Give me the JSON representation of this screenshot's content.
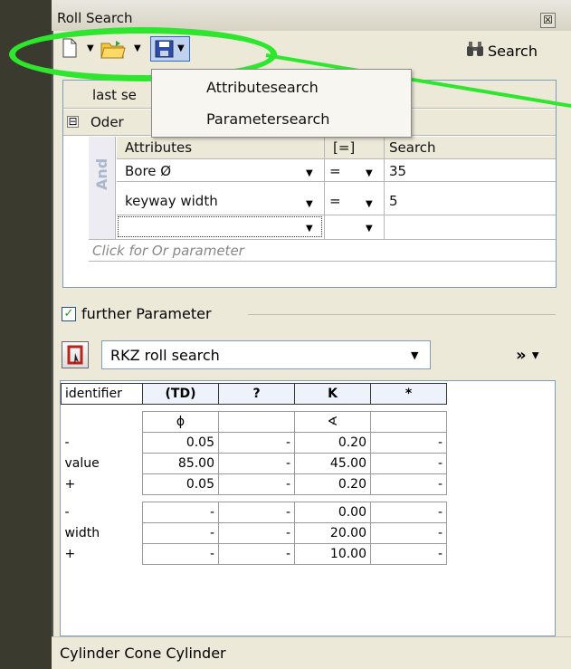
{
  "window": {
    "title": "Roll Search",
    "close_symbol": "☒"
  },
  "toolbar": {
    "search_label": "Search"
  },
  "dropdown_menu": {
    "items": [
      "Attributesearch",
      "Parametersearch"
    ]
  },
  "attribute_grid": {
    "tab_label": "last se",
    "group_label": "Oder",
    "and_label": "And",
    "headers": {
      "attributes": "Attributes",
      "operator": "[=]",
      "search": "Search"
    },
    "rows": [
      {
        "attribute": "Bore Ø",
        "operator": "=",
        "value": "35"
      },
      {
        "attribute": "keyway width",
        "operator": "=",
        "value": "5"
      },
      {
        "attribute": "",
        "operator": "",
        "value": ""
      }
    ],
    "or_placeholder": "Click for Or parameter",
    "expander_symbol": "⊟"
  },
  "further_parameter": {
    "label": "further Parameter",
    "checked": true
  },
  "roll_search": {
    "selected": "RKZ roll search",
    "more_symbol": "»"
  },
  "param_table": {
    "identifier_label": "identifier",
    "columns": [
      "(TD)",
      "?",
      "K",
      "*"
    ],
    "symbols": [
      "ϕ",
      "",
      "∢",
      ""
    ],
    "blocks": [
      {
        "rows": [
          {
            "label": "-",
            "values": [
              "0.05",
              "-",
              "0.20",
              "-"
            ]
          },
          {
            "label": "value",
            "values": [
              "85.00",
              "-",
              "45.00",
              "-"
            ]
          },
          {
            "label": "+",
            "values": [
              "0.05",
              "-",
              "0.20",
              "-"
            ]
          }
        ]
      },
      {
        "rows": [
          {
            "label": "-",
            "values": [
              "-",
              "-",
              "0.00",
              "-"
            ]
          },
          {
            "label": "width",
            "values": [
              "-",
              "-",
              "20.00",
              "-"
            ]
          },
          {
            "label": "+",
            "values": [
              "-",
              "-",
              "10.00",
              "-"
            ]
          }
        ]
      }
    ]
  },
  "status_bar": {
    "text": "Cylinder Cone Cylinder"
  },
  "annotation_color": "#2ee62e"
}
